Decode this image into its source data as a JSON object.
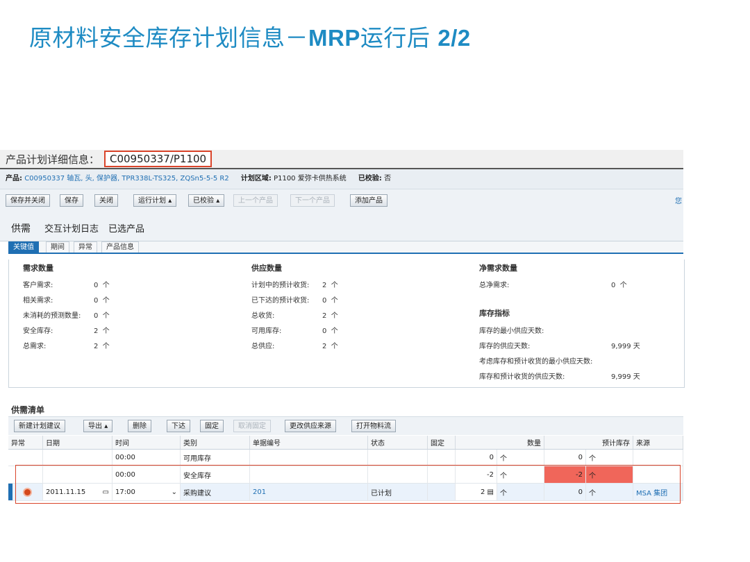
{
  "slide": {
    "title_cn": "原材料安全库存计划信息－",
    "title_bold": "MRP",
    "title_cn2": "运行后",
    "title_page": "2/2"
  },
  "header": {
    "label": "产品计划详细信息：",
    "product_id": "C00950337/P1100"
  },
  "info": {
    "product_label": "产品:",
    "product_value": "C00950337 轴瓦, 头, 保护器, TPR338L-TS325, ZQSn5-5-5 R2",
    "area_label": "计划区域:",
    "area_value": "P1100 爱弥卡供热系统",
    "checked_label": "已校验:",
    "checked_value": "否"
  },
  "toolbar": {
    "save_close": "保存并关闭",
    "save": "保存",
    "close": "关闭",
    "run_plan": "运行计划",
    "checked": "已校验",
    "prev": "上一个产品",
    "next": "下一个产品",
    "add": "添加产品",
    "corner": "您"
  },
  "tabs": [
    "供需",
    "交互计划日志",
    "已选产品"
  ],
  "subtabs": [
    "关键值",
    "期间",
    "异常",
    "产品信息"
  ],
  "demand": {
    "title": "需求数量",
    "items": [
      {
        "label": "客户需求:",
        "value": "0",
        "unit": "个"
      },
      {
        "label": "相关需求:",
        "value": "0",
        "unit": "个"
      },
      {
        "label": "未消耗的预测数量:",
        "value": "0",
        "unit": "个"
      },
      {
        "label": "安全库存:",
        "value": "2",
        "unit": "个"
      },
      {
        "label": "总需求:",
        "value": "2",
        "unit": "个"
      }
    ]
  },
  "supply": {
    "title": "供应数量",
    "items": [
      {
        "label": "计划中的预计收货:",
        "value": "2",
        "unit": "个"
      },
      {
        "label": "已下达的预计收货:",
        "value": "0",
        "unit": "个"
      },
      {
        "label": "总收货:",
        "value": "2",
        "unit": "个"
      },
      {
        "label": "可用库存:",
        "value": "0",
        "unit": "个"
      },
      {
        "label": "总供应:",
        "value": "2",
        "unit": "个"
      }
    ]
  },
  "net": {
    "title": "净需求数量",
    "label": "总净需求:",
    "value": "0",
    "unit": "个"
  },
  "inventory": {
    "title": "库存指标",
    "items": [
      {
        "label": "库存的最小供应天数:",
        "value": ""
      },
      {
        "label": "库存的供应天数:",
        "value": "9,999 天"
      },
      {
        "label": "考虑库存和预计收货的最小供应天数:",
        "value": ""
      },
      {
        "label": "库存和预计收货的供应天数:",
        "value": "9,999 天"
      }
    ]
  },
  "list": {
    "title": "供需清单",
    "buttons": {
      "new_proposal": "新建计划建议",
      "export": "导出",
      "delete": "删除",
      "release": "下达",
      "fix": "固定",
      "unfix": "取消固定",
      "change_source": "更改供应来源",
      "material_flow": "打开物料流"
    },
    "columns": [
      "异常",
      "日期",
      "时间",
      "类别",
      "单据编号",
      "状态",
      "固定",
      "数量",
      "预计库存",
      "来源"
    ],
    "rows": [
      {
        "date": "",
        "time": "00:00",
        "category": "可用库存",
        "doc": "",
        "status": "",
        "qty": "0",
        "qty_unit": "个",
        "stock": "0",
        "stock_unit": "个",
        "source": ""
      },
      {
        "date": "",
        "time": "00:00",
        "category": "安全库存",
        "doc": "",
        "status": "",
        "qty": "-2",
        "qty_unit": "个",
        "stock": "-2",
        "stock_unit": "个",
        "source": ""
      },
      {
        "date": "2011.11.15",
        "time": "17:00",
        "category": "采购建议",
        "doc": "201",
        "status": "已计划",
        "qty": "2",
        "qty_unit": "个",
        "stock": "0",
        "stock_unit": "个",
        "source": "MSA 集团"
      }
    ]
  },
  "colors": {
    "title_blue": "#1e8bc3",
    "highlight_red": "#d9442a",
    "link_blue": "#1f6fb3",
    "stock_red": "#f0665a"
  }
}
